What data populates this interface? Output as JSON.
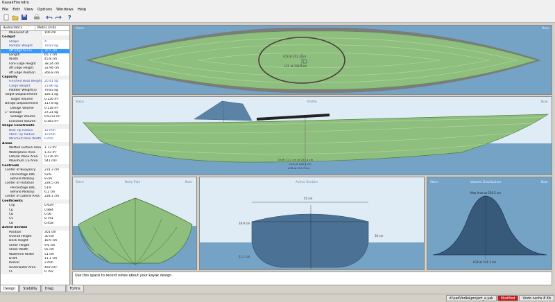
{
  "window": {
    "title": "KayakFoundry"
  },
  "menu": [
    "File",
    "Edit",
    "View",
    "Options",
    "Windows",
    "Help"
  ],
  "toolbar": {
    "icons": [
      "new-file-icon",
      "open-folder-icon",
      "save-icon",
      "print-icon",
      "undo-icon",
      "redo-icon",
      "help-icon"
    ]
  },
  "panel": {
    "header_left": "Hydrostatics",
    "header_right": "Metric Units",
    "measured_at": {
      "label": "Measured at",
      "value": "100 cm"
    },
    "cockpit": {
      "title": "Cockpit",
      "rows": [
        {
          "name": "Shape",
          "value": "A",
          "style": "blue"
        },
        {
          "name": "Paddler Weight",
          "value": "79.83 kg",
          "style": "blue"
        },
        {
          "name": "Aft edge to CG",
          "value": "35.5 cm",
          "style": "sel"
        },
        {
          "name": "Length",
          "value": "65.7 cm"
        },
        {
          "name": "Width",
          "value": "45.8 cm"
        },
        {
          "name": "Fore Edge Height",
          "value": "38.24 cm"
        },
        {
          "name": "Aft Edge Height",
          "value": "32.94 cm"
        },
        {
          "name": "Aft Edge Position",
          "value": "266.8 cm"
        }
      ]
    },
    "capacity": {
      "title": "Capacity",
      "rows": [
        {
          "name": "Finished Boat Weight",
          "value": "20.41 kg",
          "style": "blue"
        },
        {
          "name": "Cargo Weight",
          "value": "23.86 kg",
          "style": "blue"
        },
        {
          "name": "Paddler Weight(s)",
          "value": "79.83 kg"
        },
        {
          "name": "Target Displacement",
          "value": "126.1 kg",
          "style": "grp"
        },
        {
          "name": "Target Volume",
          "value": "0.126 m³",
          "style": "sub"
        },
        {
          "name": "Design Displacement",
          "value": "117.8 kg",
          "style": "grp"
        },
        {
          "name": "Design Volume",
          "value": "0.118 m³",
          "style": "sub"
        },
        {
          "name": "1\" Sinkage",
          "value": "37.21 kg",
          "style": "grp"
        },
        {
          "name": "Sinkage Volume",
          "value": "0.0372 m³",
          "style": "sub"
        },
        {
          "name": "Enclosed Volume",
          "value": "0.383 m³"
        }
      ]
    },
    "shape": {
      "title": "Shape Constraints",
      "rows": [
        {
          "name": "Bow Tip Radius",
          "value": "15 mm",
          "style": "blue"
        },
        {
          "name": "Stern Tip Radius",
          "value": "10 mm",
          "style": "blue"
        },
        {
          "name": "Minimum Keel Width",
          "value": "0 mm",
          "style": "blue"
        }
      ]
    },
    "areas": {
      "title": "Areas",
      "rows": [
        {
          "name": "Wetted surface Area",
          "value": "1.73 m²"
        },
        {
          "name": "Waterplane Area",
          "value": "1.43 m²"
        },
        {
          "name": "Lateral Plane Area",
          "value": "0.376 m²"
        },
        {
          "name": "Maximum CS Area",
          "value": "541 cm²"
        }
      ]
    },
    "centroids": {
      "title": "Centroids",
      "rows": [
        {
          "name": "Center of Buoyancy",
          "value": "231.3 cm",
          "style": "grp"
        },
        {
          "name": "Percentage LWL",
          "value": "52%",
          "style": "sub"
        },
        {
          "name": "Behind Midship",
          "value": "9 cm",
          "style": "sub"
        },
        {
          "name": "Center of Flotation",
          "value": "228.5 cm",
          "style": "grp"
        },
        {
          "name": "Percentage LWL",
          "value": "51%",
          "style": "sub"
        },
        {
          "name": "Behind Midship",
          "value": "6.2 cm",
          "style": "sub"
        },
        {
          "name": "Center of Lateral Area",
          "value": "228.1 cm",
          "style": "grp"
        }
      ]
    },
    "coefficients": {
      "title": "Coefficients",
      "rows": [
        {
          "name": "Csp",
          "value": "0.629"
        },
        {
          "name": "Cp",
          "value": "0.884"
        },
        {
          "name": "Cb",
          "value": "0.56"
        },
        {
          "name": "Cv",
          "value": "0.791"
        },
        {
          "name": "Cb",
          "value": "0.458"
        }
      ]
    },
    "active_section": {
      "title": "Active Section",
      "rows": [
        {
          "name": "Position",
          "value": "301 cm"
        },
        {
          "name": "Overall Height",
          "value": "30 cm"
        },
        {
          "name": "Deck Height",
          "value": "18.9 cm"
        },
        {
          "name": "Sheer Height",
          "value": "9.6 cm"
        },
        {
          "name": "Sheer Width",
          "value": "55 cm"
        },
        {
          "name": "Waterline Width",
          "value": "51 cm"
        },
        {
          "name": "Draft",
          "value": "11.1 cm"
        },
        {
          "name": "Rocker",
          "value": "2 mm"
        },
        {
          "name": "Underwater Area",
          "value": "450 cm²"
        },
        {
          "name": "CF",
          "value": "0.792"
        }
      ]
    }
  },
  "tabs": [
    "Design",
    "Stability",
    "Drag Prediction",
    "Forms"
  ],
  "views": {
    "plan": {
      "left": "Stern",
      "right": "Bow",
      "label1": "LCB at 231.3 cm",
      "label2": "LCF at 228.5 cm"
    },
    "profile": {
      "left": "Stern",
      "title": "Profile",
      "right": "Bow",
      "labels": [
        "Draft 11.1 cm at 233.4 cm",
        "CLA at 228.1 cm",
        "LCB at 231.3 cm"
      ]
    },
    "body": {
      "left": "Stern",
      "title": "Body Plan",
      "right": "Bow"
    },
    "section": {
      "title": "Active Section",
      "width": "55 cm",
      "left_h": "18.9 cm",
      "right_h": "30 cm",
      "draft": "11.1 cm"
    },
    "volume": {
      "left": "Stern",
      "title": "Volume Distribution",
      "right": "Bow",
      "max_label": "Max Area at 228.5 cm",
      "lcb_label": "LCB at 231.3 cm"
    }
  },
  "colors": {
    "water": "#74a3c6",
    "sky": "#e0ecf5",
    "hull": "#8fbf7e",
    "deck": "#5a83a6",
    "section": "#4b7194",
    "volume": "#37597a"
  },
  "notes": "Use this space to record notes about your kayak design.",
  "status": {
    "path": "d:\\sad\\fodka\\project_a.yak",
    "modified": "Modified",
    "undo": "Undo cache 8 Kb"
  }
}
